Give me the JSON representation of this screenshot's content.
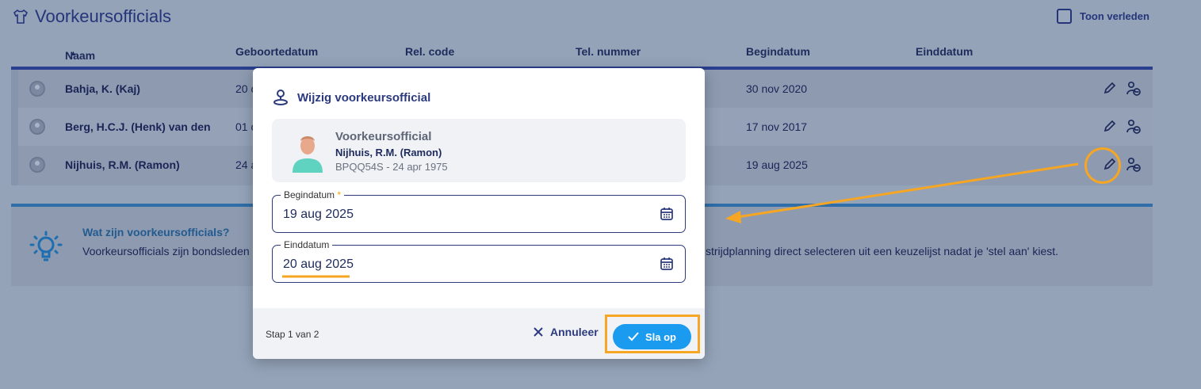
{
  "page": {
    "title": "Voorkeursofficials",
    "toggle_label": "Toon verleden"
  },
  "table": {
    "columns": [
      "Naam",
      "Geboortedatum",
      "Rel. code",
      "Tel. nummer",
      "Begindatum",
      "Einddatum"
    ],
    "rows": [
      {
        "name": "Bahja, K. (Kaj)",
        "birth_partial": "20 c",
        "begin": "30 nov 2020"
      },
      {
        "name": "Berg, H.C.J. (Henk) van den",
        "birth_partial": "01 c",
        "begin": "17 nov 2017"
      },
      {
        "name": "Nijhuis, R.M. (Ramon)",
        "birth_partial": "24 a",
        "begin": "19 aug 2025"
      }
    ]
  },
  "info": {
    "heading": "Wat zijn voorkeursofficials?",
    "text_left": "Voorkeursofficials zijn bondsleden",
    "text_right": "strijdplanning direct selecteren uit een keuzelijst nadat je 'stel aan' kiest."
  },
  "modal": {
    "title": "Wijzig voorkeursofficial",
    "card": {
      "role": "Voorkeursofficial",
      "name": "Nijhuis, R.M. (Ramon)",
      "sub": "BPQQ54S - 24 apr 1975"
    },
    "begin_label": "Begindatum",
    "begin_required": "*",
    "begin_value": "19 aug 2025",
    "end_label": "Einddatum",
    "end_value": "20 aug 2025",
    "step": "Stap 1 van 2",
    "cancel_label": "Annuleer",
    "save_label": "Sla op"
  },
  "colors": {
    "accent": "#1a9bf0",
    "highlight": "#f6a623",
    "navy": "#2c3a7e"
  }
}
